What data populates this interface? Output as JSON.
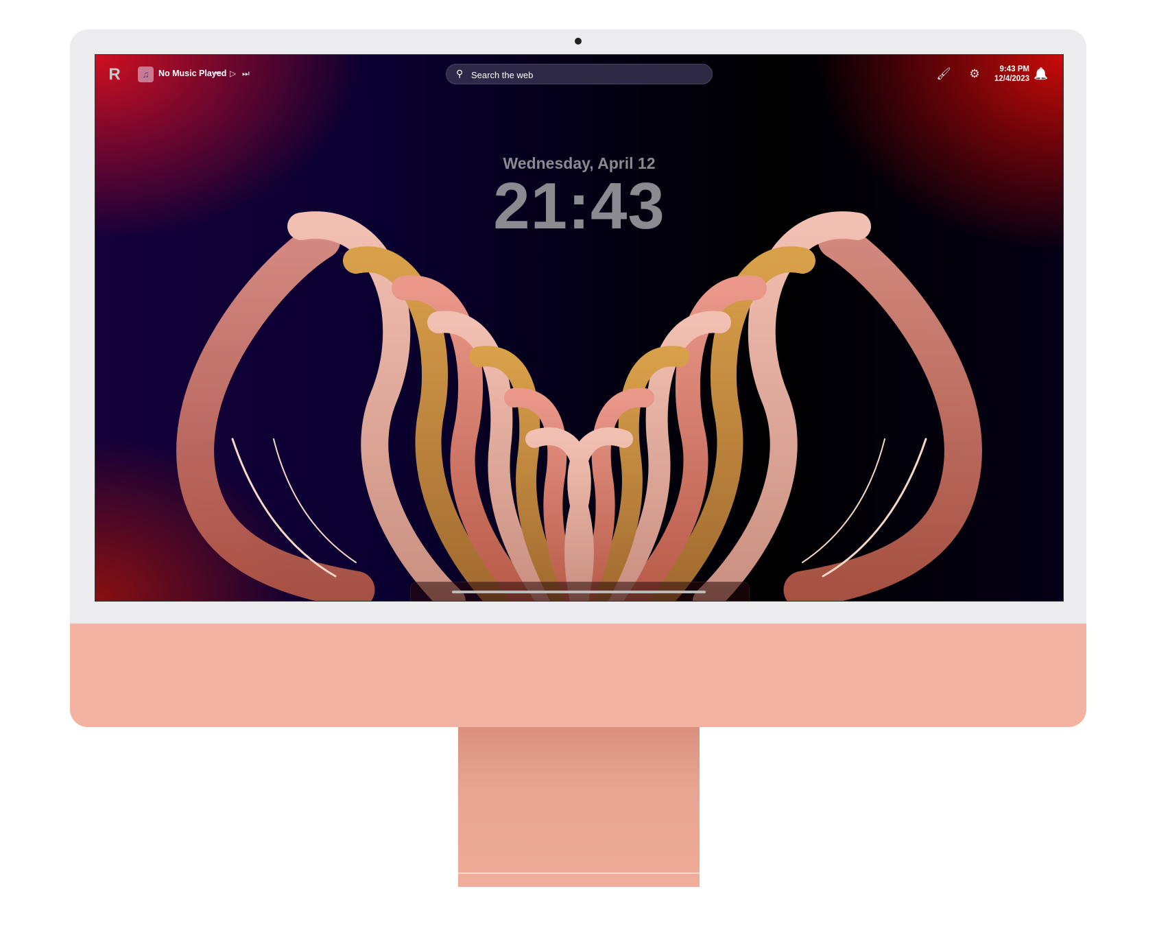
{
  "topbar": {
    "logo_letter": "R",
    "music": {
      "title": "No Music Played",
      "art_icon": "music-note-icon"
    },
    "controls": [
      {
        "name": "previous",
        "glyph": "⏮"
      },
      {
        "name": "play",
        "glyph": "▷"
      },
      {
        "name": "next",
        "glyph": "⏭"
      }
    ],
    "search": {
      "placeholder": "Search the web",
      "icon": "⚲"
    },
    "tray": {
      "brush_icon": "🖌",
      "gear_icon": "⚙",
      "time": "9:43 PM",
      "date": "12/4/2023",
      "bell_icon": "🔔"
    }
  },
  "lockscreen": {
    "date": "Wednesday, April 12",
    "time": "21:43"
  },
  "colors": {
    "chin": "#f2b3a2",
    "bezel": "#ececee",
    "accent_red": "#c80c08"
  }
}
